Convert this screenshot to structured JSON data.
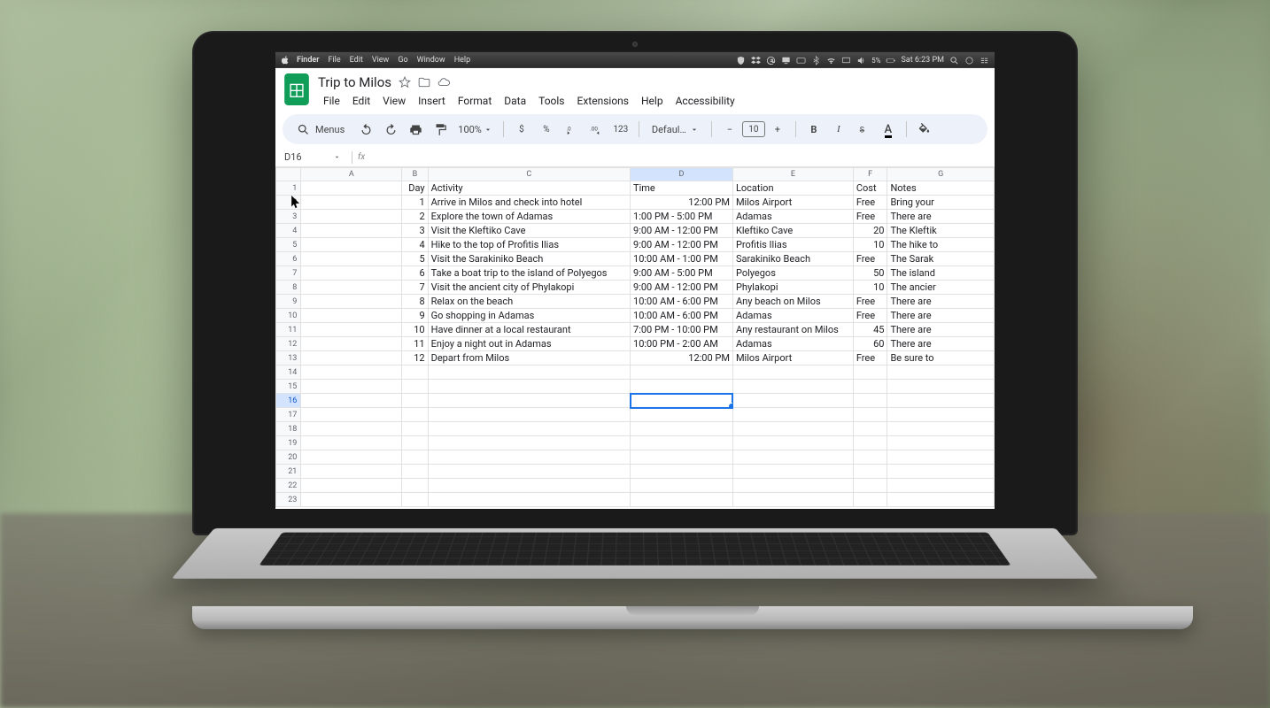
{
  "mac_menubar": {
    "app": "Finder",
    "menus": [
      "File",
      "Edit",
      "View",
      "Go",
      "Window",
      "Help"
    ],
    "battery": "5%",
    "clock": "Sat 6:23 PM"
  },
  "doc": {
    "title": "Trip to Milos",
    "app_menus": [
      "File",
      "Edit",
      "View",
      "Insert",
      "Format",
      "Data",
      "Tools",
      "Extensions",
      "Help",
      "Accessibility"
    ]
  },
  "toolbar": {
    "menus_search": "Menus",
    "zoom": "100%",
    "font": "Defaul…",
    "fontsize": "10",
    "numfmt_123": "123"
  },
  "namebox": {
    "ref": "D16"
  },
  "sheet": {
    "columns": [
      "A",
      "B",
      "C",
      "D",
      "E",
      "F",
      "G"
    ],
    "col_widths": [
      "col-A",
      "col-B",
      "col-C",
      "col-D",
      "col-E",
      "col-F",
      "col-G"
    ],
    "selected": {
      "row": 16,
      "col": "D"
    },
    "header_row": [
      "",
      "Day",
      "Activity",
      "Time",
      "Location",
      "Cost",
      "Notes"
    ],
    "rows": [
      {
        "day": "1",
        "activity": "Arrive in Milos and check into hotel",
        "time": "12:00 PM",
        "time_align": "right",
        "location": "Milos Airport",
        "cost": "Free",
        "cost_num": false,
        "notes": "Bring your"
      },
      {
        "day": "2",
        "activity": "Explore the town of Adamas",
        "time": "1:00 PM - 5:00 PM",
        "time_align": "left",
        "location": "Adamas",
        "cost": "Free",
        "cost_num": false,
        "notes": "There are"
      },
      {
        "day": "3",
        "activity": "Visit the Kleftiko Cave",
        "time": "9:00 AM - 12:00 PM",
        "time_align": "left",
        "location": "Kleftiko Cave",
        "cost": "20",
        "cost_num": true,
        "notes": "The Kleftik"
      },
      {
        "day": "4",
        "activity": "Hike to the top of Profitis Ilias",
        "time": "9:00 AM - 12:00 PM",
        "time_align": "left",
        "location": "Profitis Ilias",
        "cost": "10",
        "cost_num": true,
        "notes": "The hike to"
      },
      {
        "day": "5",
        "activity": "Visit the Sarakiniko Beach",
        "time": "10:00 AM - 1:00 PM",
        "time_align": "left",
        "location": "Sarakiniko Beach",
        "cost": "Free",
        "cost_num": false,
        "notes": "The Sarak"
      },
      {
        "day": "6",
        "activity": "Take a boat trip to the island of Polyegos",
        "time": "9:00 AM - 5:00 PM",
        "time_align": "left",
        "location": "Polyegos",
        "cost": "50",
        "cost_num": true,
        "notes": "The island"
      },
      {
        "day": "7",
        "activity": "Visit the ancient city of Phylakopi",
        "time": "9:00 AM - 12:00 PM",
        "time_align": "left",
        "location": "Phylakopi",
        "cost": "10",
        "cost_num": true,
        "notes": "The ancier"
      },
      {
        "day": "8",
        "activity": "Relax on the beach",
        "time": "10:00 AM - 6:00 PM",
        "time_align": "left",
        "location": "Any beach on Milos",
        "cost": "Free",
        "cost_num": false,
        "notes": "There are"
      },
      {
        "day": "9",
        "activity": "Go shopping in Adamas",
        "time": "10:00 AM - 6:00 PM",
        "time_align": "left",
        "location": "Adamas",
        "cost": "Free",
        "cost_num": false,
        "notes": "There are"
      },
      {
        "day": "10",
        "activity": "Have dinner at a local restaurant",
        "time": "7:00 PM - 10:00 PM",
        "time_align": "left",
        "location": "Any restaurant on Milos",
        "cost": "45",
        "cost_num": true,
        "notes": "There are"
      },
      {
        "day": "11",
        "activity": "Enjoy a night out in Adamas",
        "time": "10:00 PM - 2:00 AM",
        "time_align": "left",
        "location": "Adamas",
        "cost": "60",
        "cost_num": true,
        "notes": "There are"
      },
      {
        "day": "12",
        "activity": "Depart from Milos",
        "time": "12:00 PM",
        "time_align": "right",
        "location": "Milos Airport",
        "cost": "Free",
        "cost_num": false,
        "notes": "Be sure to"
      }
    ],
    "total_rows": 23
  }
}
